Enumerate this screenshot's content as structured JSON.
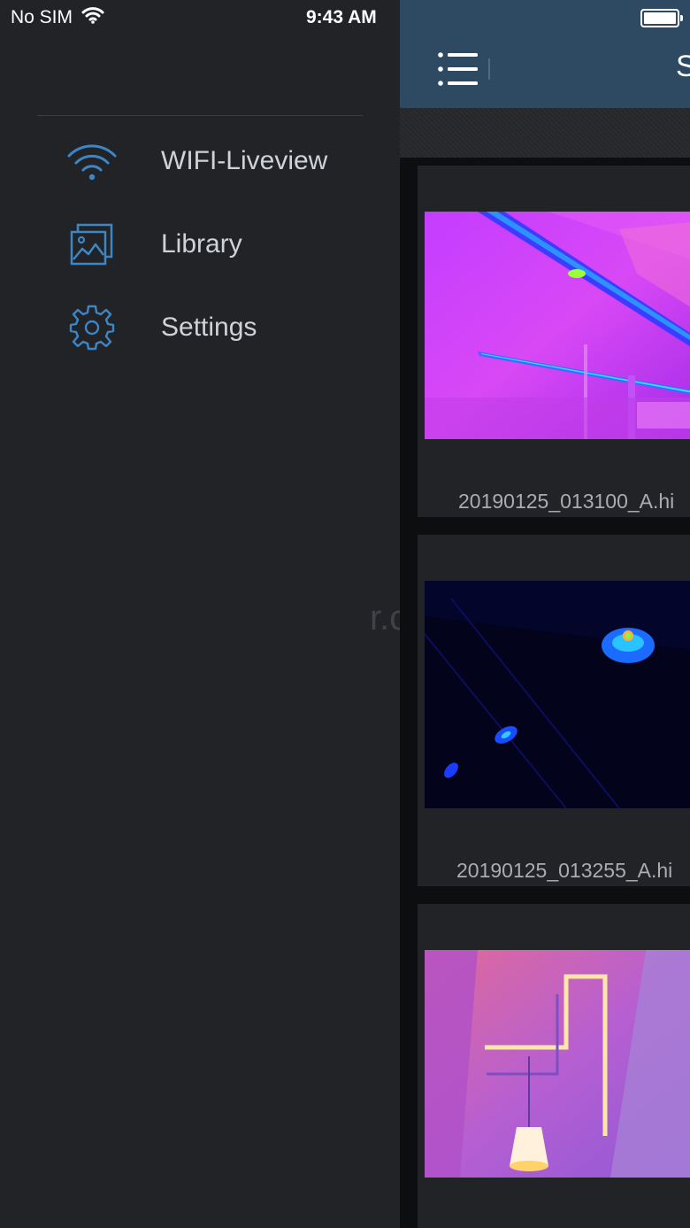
{
  "status_bar": {
    "carrier": "No SIM",
    "time": "9:43 AM"
  },
  "drawer": {
    "items": [
      {
        "label": "WIFI-Liveview",
        "icon": "wifi-icon"
      },
      {
        "label": "Library",
        "icon": "gallery-icon"
      },
      {
        "label": "Settings",
        "icon": "gear-icon"
      }
    ],
    "watermark": "r.com"
  },
  "main": {
    "title": "S",
    "files": [
      {
        "name": "20190125_013100_A.hi"
      },
      {
        "name": "20190125_013255_A.hi"
      },
      {
        "name": ""
      }
    ]
  },
  "colors": {
    "nav_bar": "#2e4a62",
    "icon_accent": "#3d86c6",
    "drawer_bg": "#222327"
  }
}
